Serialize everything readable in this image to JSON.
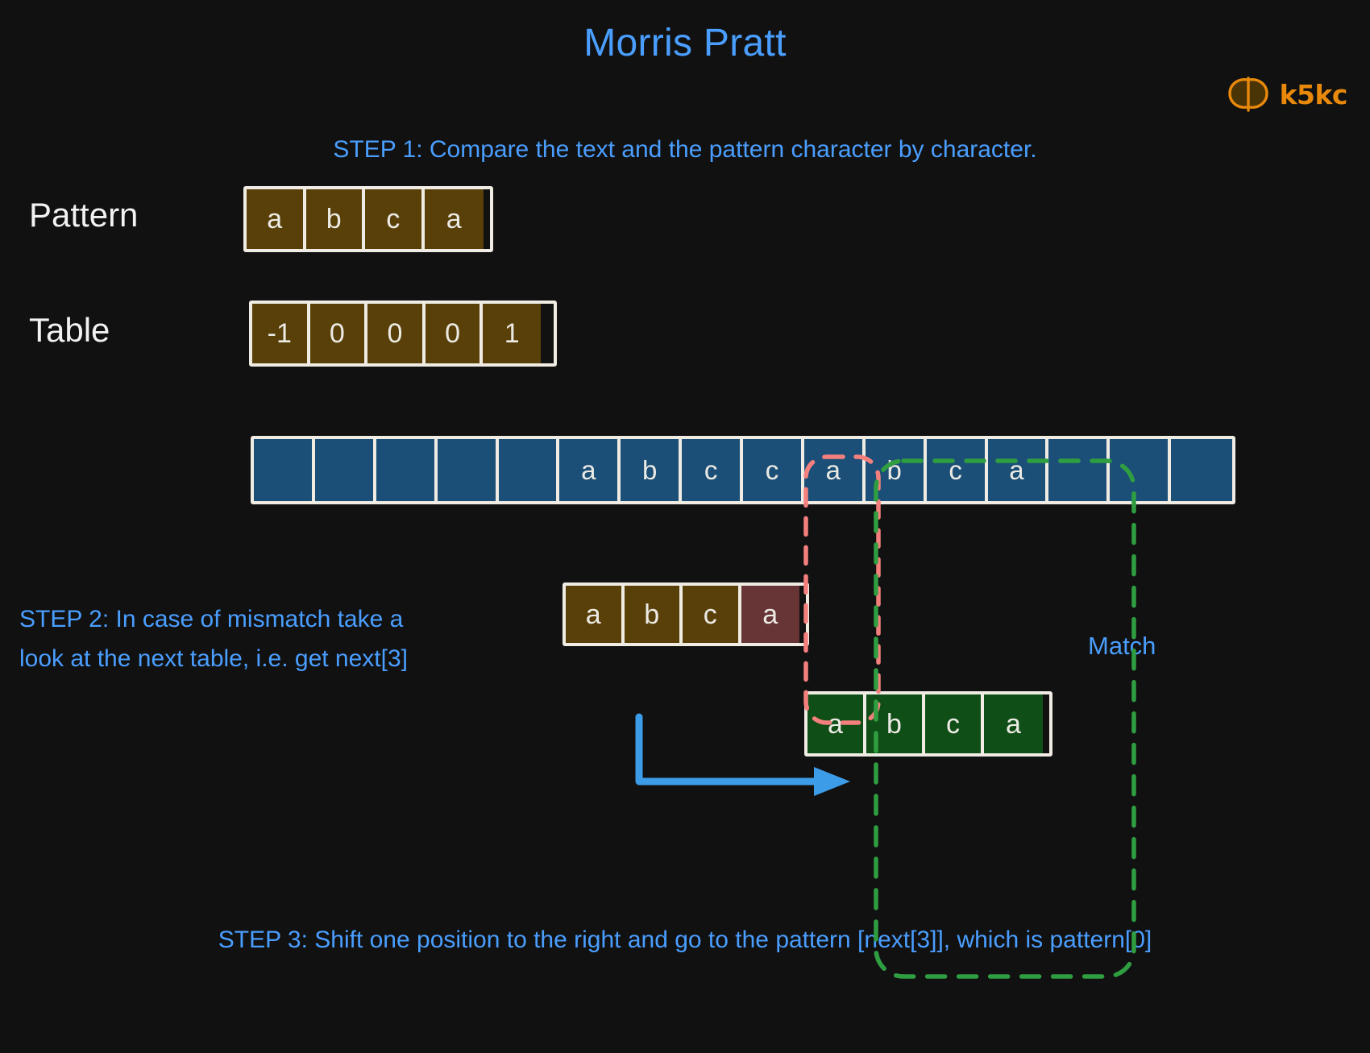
{
  "page": {
    "title": "Morris Pratt",
    "background_color": "#111111",
    "accent_color": "#4a9eff"
  },
  "logo": {
    "mark": "butterfly-icon",
    "text": "k5kc",
    "color": "#e8890c"
  },
  "steps": {
    "step1": "STEP 1: Compare the text and the pattern character by character.",
    "step2": "STEP 2: In case of mismatch take a\nlook at the next table, i.e. get next[3]",
    "step3": "STEP 3: Shift one position to the right and go to the pattern [next[3]], which is pattern[0]"
  },
  "labels": {
    "pattern": "Pattern",
    "table": "Table",
    "match": "Match"
  },
  "colors": {
    "olive_cell": "#584008",
    "blue_cell": "#1b4f77",
    "green_cell": "#0f4e16",
    "mismatch_cell": "#683536",
    "cell_border": "#f0ece4",
    "mismatch_outline": "#f4807d",
    "match_outline": "#2f9e41",
    "arrow": "#3d9ce8"
  },
  "pattern_row": {
    "name": "pattern",
    "cells": [
      "a",
      "b",
      "c",
      "a"
    ]
  },
  "table_row": {
    "name": "next-table",
    "cells": [
      "-1",
      "0",
      "0",
      "0",
      "1"
    ]
  },
  "text_row": {
    "name": "text",
    "cells": [
      "",
      "",
      "",
      "",
      "",
      "a",
      "b",
      "c",
      "c",
      "a",
      "b",
      "c",
      "a",
      "",
      "",
      ""
    ]
  },
  "pattern_shifted": {
    "name": "pattern-at-mismatch",
    "cells": [
      "a",
      "b",
      "c",
      "a"
    ],
    "mismatch_index": 3
  },
  "pattern_match": {
    "name": "pattern-shifted-match",
    "cells": [
      "a",
      "b",
      "c",
      "a"
    ]
  }
}
